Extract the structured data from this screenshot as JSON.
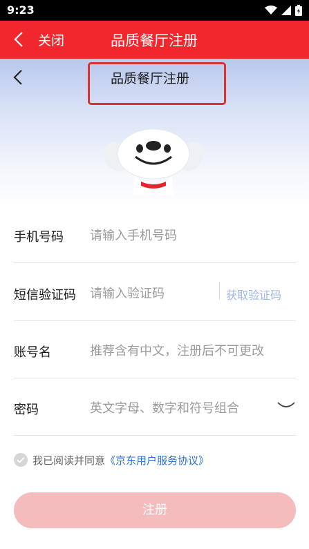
{
  "status_bar": {
    "time": "9:23"
  },
  "header": {
    "close_label": "关闭",
    "title": "品质餐厅注册"
  },
  "subheader": {
    "title": "品质餐厅注册"
  },
  "form": {
    "phone": {
      "label": "手机号码",
      "placeholder": "请输入手机号码"
    },
    "sms": {
      "label": "短信验证码",
      "placeholder": "请输入验证码",
      "get_code": "获取验证码"
    },
    "account": {
      "label": "账号名",
      "placeholder": "推荐含有中文，注册后不可更改"
    },
    "password": {
      "label": "密码",
      "placeholder": "英文字母、数字和符号组合"
    }
  },
  "agreement": {
    "text": "我已阅读并同意",
    "link": "《京东用户服务协议》"
  },
  "register_button": "注册",
  "colors": {
    "header_red": "#f2272d",
    "button_disabled": "#f5bcbd",
    "link_blue": "#2f6fd6",
    "highlight_box": "#d9342f"
  }
}
